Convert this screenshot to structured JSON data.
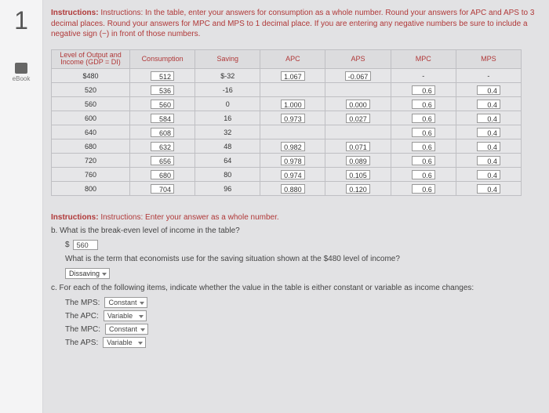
{
  "sidebar": {
    "chapter": "1",
    "ebook": "eBook"
  },
  "instructions_a": "Instructions: In the table, enter your answers for consumption as a whole number. Round your answers for APC and APS to 3 decimal places. Round your answers for MPC and MPS to 1 decimal place. If you are entering any negative numbers be sure to include a negative sign (−) in front of those numbers.",
  "table": {
    "headers": {
      "level": "Level of Output and Income (GDP = DI)",
      "consumption": "Consumption",
      "saving": "Saving",
      "apc": "APC",
      "aps": "APS",
      "mpc": "MPC",
      "mps": "MPS"
    },
    "rows": [
      {
        "gdp": "$480",
        "cons": "512",
        "sav": "$-32",
        "apc": "1.067",
        "aps": "-0.067",
        "mpc": "-",
        "mps": "-"
      },
      {
        "gdp": "520",
        "cons": "536",
        "sav": "-16",
        "apc": "",
        "aps": "",
        "mpc": "0.6",
        "mps": "0.4"
      },
      {
        "gdp": "560",
        "cons": "560",
        "sav": "0",
        "apc": "1.000",
        "aps": "0.000",
        "mpc": "0.6",
        "mps": "0.4"
      },
      {
        "gdp": "600",
        "cons": "584",
        "sav": "16",
        "apc": "0.973",
        "aps": "0.027",
        "mpc": "0.6",
        "mps": "0.4"
      },
      {
        "gdp": "640",
        "cons": "608",
        "sav": "32",
        "apc": "",
        "aps": "",
        "mpc": "0.6",
        "mps": "0.4"
      },
      {
        "gdp": "680",
        "cons": "632",
        "sav": "48",
        "apc": "0.982",
        "aps": "0.071",
        "mpc": "0.6",
        "mps": "0.4"
      },
      {
        "gdp": "720",
        "cons": "656",
        "sav": "64",
        "apc": "0.978",
        "aps": "0.089",
        "mpc": "0.6",
        "mps": "0.4"
      },
      {
        "gdp": "760",
        "cons": "680",
        "sav": "80",
        "apc": "0.974",
        "aps": "0.105",
        "mpc": "0.6",
        "mps": "0.4"
      },
      {
        "gdp": "800",
        "cons": "704",
        "sav": "96",
        "apc": "0.880",
        "aps": "0.120",
        "mpc": "0.6",
        "mps": "0.4"
      }
    ]
  },
  "instructions_b_label": "Instructions: Enter your answer as a whole number.",
  "question_b": "b. What is the break-even level of income in the table?",
  "dollar_sign": "$",
  "breakeven_value": "560",
  "term_question": "What is the term that economists use for the saving situation shown at the $480 level of income?",
  "term_value": "Dissaving",
  "question_c": "c. For each of the following items, indicate whether the value in the table is either constant or variable as income changes:",
  "opts": {
    "mps": {
      "label": "The MPS:",
      "value": "Constant"
    },
    "apc": {
      "label": "The APC:",
      "value": "Variable"
    },
    "mpc": {
      "label": "The MPC:",
      "value": "Constant"
    },
    "aps": {
      "label": "The APS:",
      "value": "Variable"
    }
  }
}
